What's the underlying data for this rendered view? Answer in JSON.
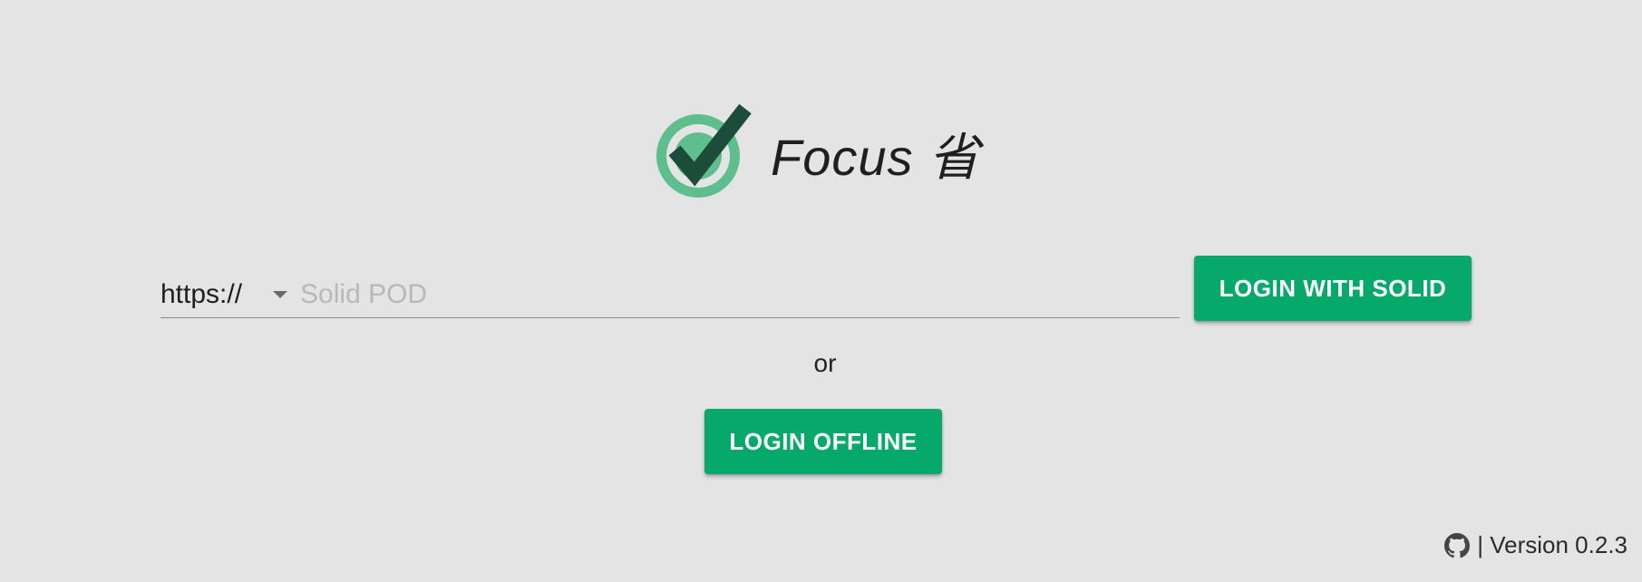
{
  "header": {
    "app_name": "Focus 省"
  },
  "login": {
    "protocol": "https://",
    "pod_placeholder": "Solid POD",
    "pod_value": "",
    "solid_button_label": "LOGIN WITH SOLID",
    "or_label": "or",
    "offline_button_label": "LOGIN OFFLINE"
  },
  "footer": {
    "version_text": "| Version 0.2.3",
    "icon": "github-icon"
  },
  "colors": {
    "background": "#e4e4e4",
    "accent": "#06a96a",
    "logo_dark": "#1b4d3a",
    "logo_ring": "#5fbe8e"
  }
}
